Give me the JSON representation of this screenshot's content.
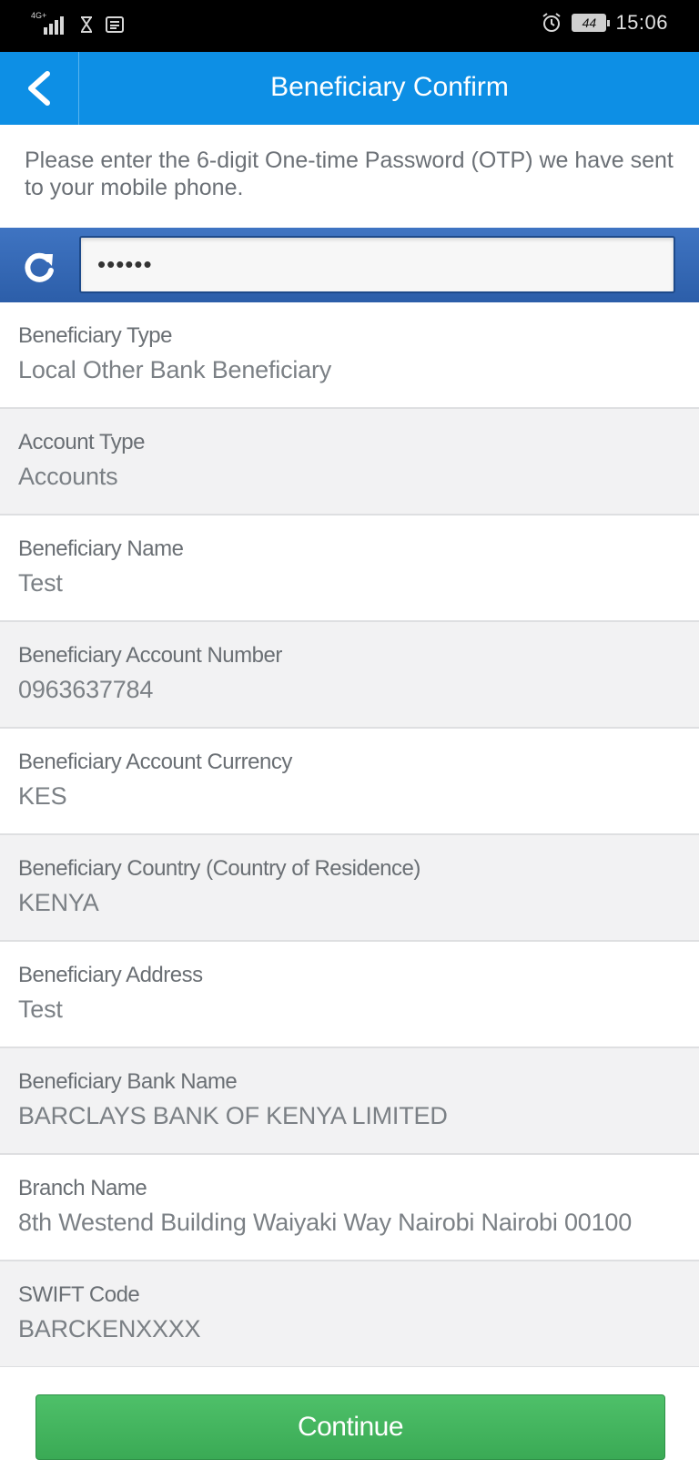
{
  "status_bar": {
    "network_label": "4G+",
    "battery_level": "44",
    "time": "15:06",
    "icons": [
      "signal-icon",
      "hourglass-icon",
      "message-icon",
      "alarm-icon",
      "battery-icon"
    ]
  },
  "header": {
    "title": "Beneficiary Confirm",
    "back_icon": "chevron-left-icon",
    "accent_color": "#0d8fe5"
  },
  "instructions": "Please enter the 6-digit One-time Password (OTP) we have sent to your mobile phone.",
  "otp": {
    "value": "••••••",
    "refresh_icon": "refresh-icon"
  },
  "details": [
    {
      "label": "Beneficiary Type",
      "value": "Local Other Bank Beneficiary"
    },
    {
      "label": "Account Type",
      "value": "Accounts"
    },
    {
      "label": "Beneficiary Name",
      "value": "Test"
    },
    {
      "label": "Beneficiary Account Number",
      "value": "0963637784"
    },
    {
      "label": "Beneficiary Account Currency",
      "value": "KES"
    },
    {
      "label": "Beneficiary Country (Country of Residence)",
      "value": "KENYA"
    },
    {
      "label": "Beneficiary Address",
      "value": "Test"
    },
    {
      "label": "Beneficiary Bank Name",
      "value": "BARCLAYS BANK OF KENYA LIMITED"
    },
    {
      "label": "Branch Name",
      "value": "8th Westend Building Waiyaki Way Nairobi Nairobi 00100"
    },
    {
      "label": "SWIFT Code",
      "value": "BARCKENXXXX"
    }
  ],
  "actions": {
    "continue_label": "Continue",
    "continue_color": "#43b35e"
  }
}
